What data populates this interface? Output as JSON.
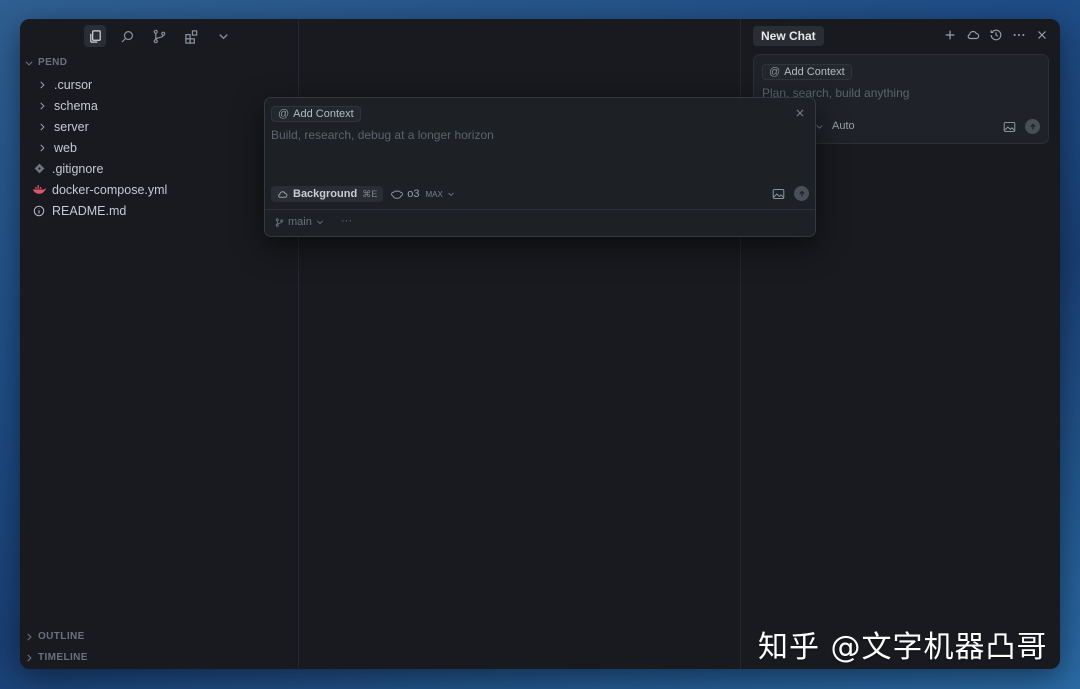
{
  "explorer": {
    "root_label": "PEND",
    "items": [
      {
        "label": ".cursor",
        "type": "folder"
      },
      {
        "label": "schema",
        "type": "folder"
      },
      {
        "label": "server",
        "type": "folder"
      },
      {
        "label": "web",
        "type": "folder"
      },
      {
        "label": ".gitignore",
        "type": "file",
        "icon": "git-diamond-icon"
      },
      {
        "label": "docker-compose.yml",
        "type": "file",
        "icon": "docker-whale-icon"
      },
      {
        "label": "README.md",
        "type": "file",
        "icon": "info-circle-icon"
      }
    ],
    "outline_label": "OUTLINE",
    "timeline_label": "TIMELINE"
  },
  "chat": {
    "tab_label": "New Chat",
    "add_context": "Add Context",
    "placeholder": "Plan, search, build anything",
    "mode": "Auto"
  },
  "popup": {
    "add_context": "Add Context",
    "placeholder": "Build, research, debug at a longer horizon",
    "background_label": "Background",
    "background_shortcut": "⌘E",
    "model": "o3",
    "model_badge": "MAX",
    "branch": "main",
    "more": "···"
  },
  "watermark": "知乎 @文字机器凸哥",
  "colors": {
    "window_bg": "#181a1f",
    "popup_bg": "#1d2025",
    "text": "#c6cad1",
    "muted": "#6b717b",
    "docker_icon": "#e0566b"
  }
}
